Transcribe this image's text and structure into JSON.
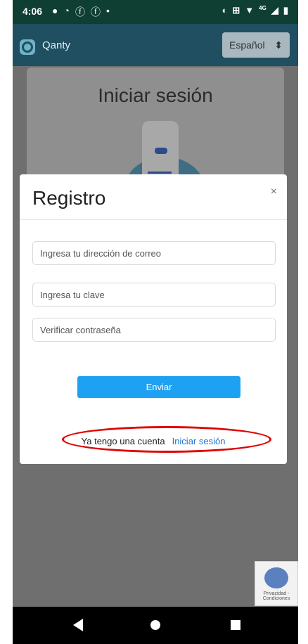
{
  "statusbar": {
    "time": "4:06",
    "network_label": "4G"
  },
  "appbar": {
    "title": "Qanty",
    "language": "Español"
  },
  "background": {
    "title": "Iniciar sesión"
  },
  "modal": {
    "title": "Registro",
    "close_symbol": "×",
    "email_placeholder": "Ingresa tu dirección de correo",
    "password_placeholder": "Ingresa tu clave",
    "confirm_placeholder": "Verificar contraseña",
    "submit_label": "Enviar",
    "footer_text": "Ya tengo una cuenta",
    "login_link": "Iniciar sesión"
  },
  "recaptcha": {
    "text": "Privacidad - Condiciones"
  },
  "colors": {
    "accent": "#1da1f2",
    "header": "#1f4f61",
    "highlight": "#e00000"
  }
}
